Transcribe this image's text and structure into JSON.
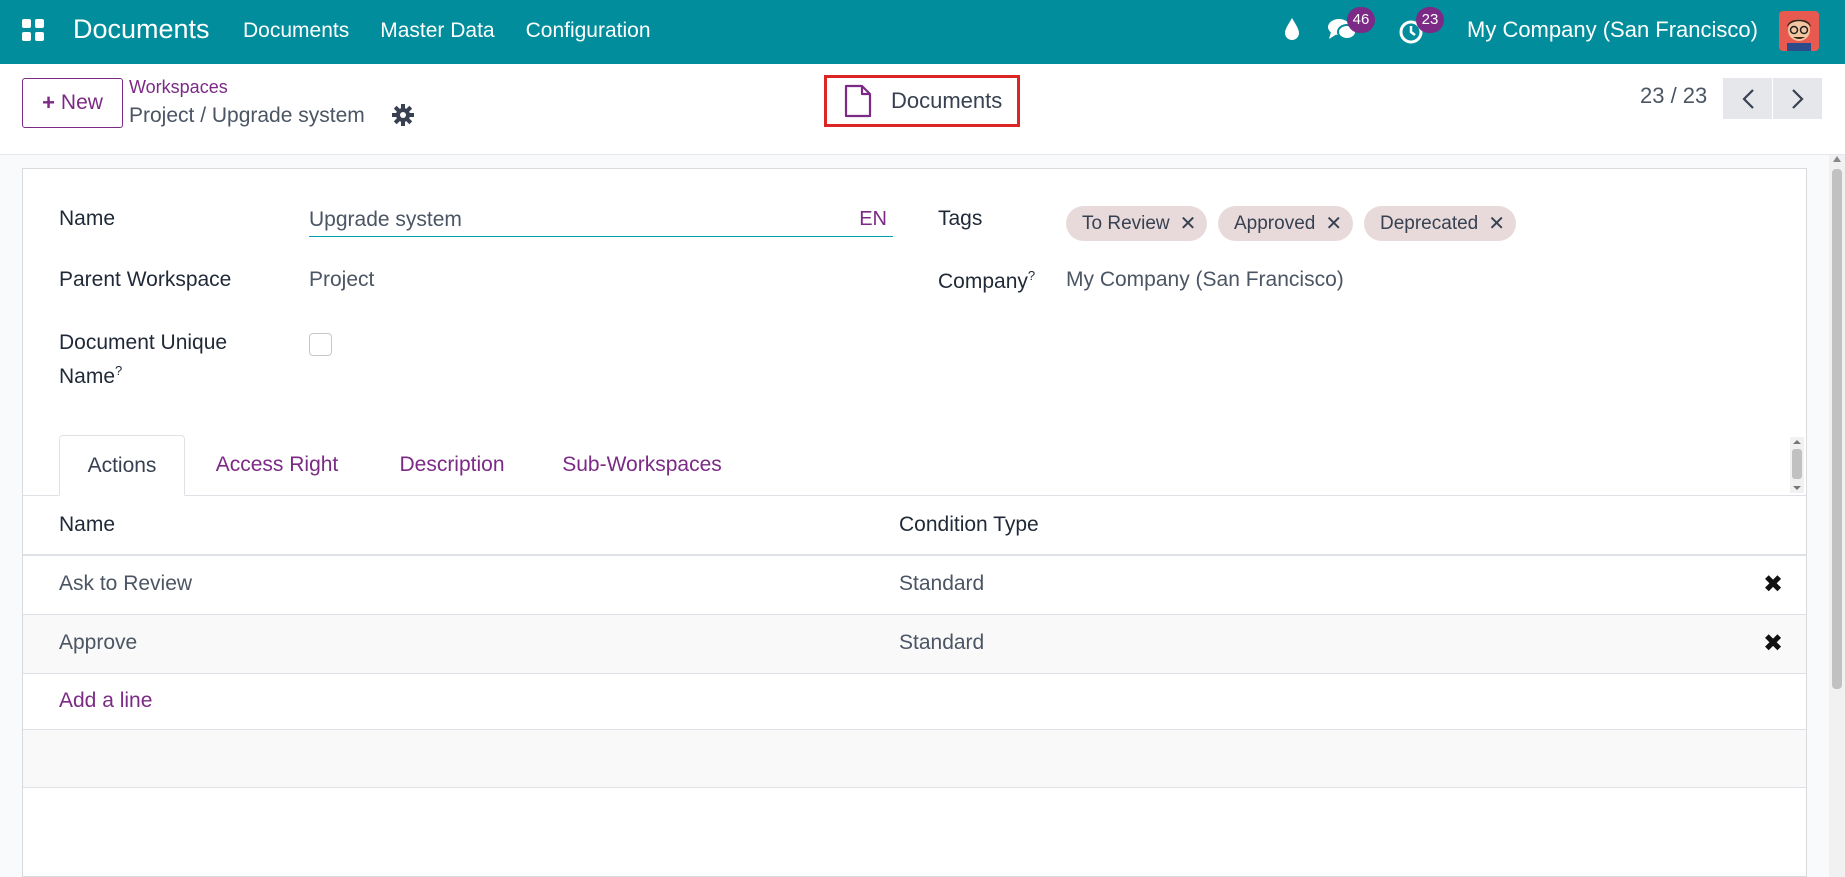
{
  "navbar": {
    "app_title": "Documents",
    "menu": [
      "Documents",
      "Master Data",
      "Configuration"
    ],
    "chat_count": "46",
    "activity_count": "23",
    "company": "My Company (San Francisco)"
  },
  "breadcrumb": {
    "parent": "Workspaces",
    "current": "Project / Upgrade system"
  },
  "new_button": "New",
  "smart_button": "Documents",
  "pager": {
    "value": "23 / 23"
  },
  "form": {
    "name_label": "Name",
    "name_value": "Upgrade system",
    "lang_button": "EN",
    "parent_label": "Parent Workspace",
    "parent_value": "Project",
    "unique_label_line1": "Document Unique",
    "unique_label_line2": "Name",
    "unique_checked": false,
    "tags_label": "Tags",
    "tags": [
      "To Review",
      "Approved",
      "Deprecated"
    ],
    "company_label": "Company",
    "company_value": "My Company (San Francisco)",
    "help_mark": "?"
  },
  "tabs": [
    "Actions",
    "Access Right",
    "Description",
    "Sub-Workspaces"
  ],
  "table": {
    "columns": [
      "Name",
      "Condition Type"
    ],
    "rows": [
      {
        "name": "Ask to Review",
        "condition": "Standard"
      },
      {
        "name": "Approve",
        "condition": "Standard"
      }
    ],
    "add_line": "Add a line"
  },
  "colors": {
    "navbar": "#018d9b",
    "accent": "#7b2a85",
    "highlight": "#dc2626"
  }
}
